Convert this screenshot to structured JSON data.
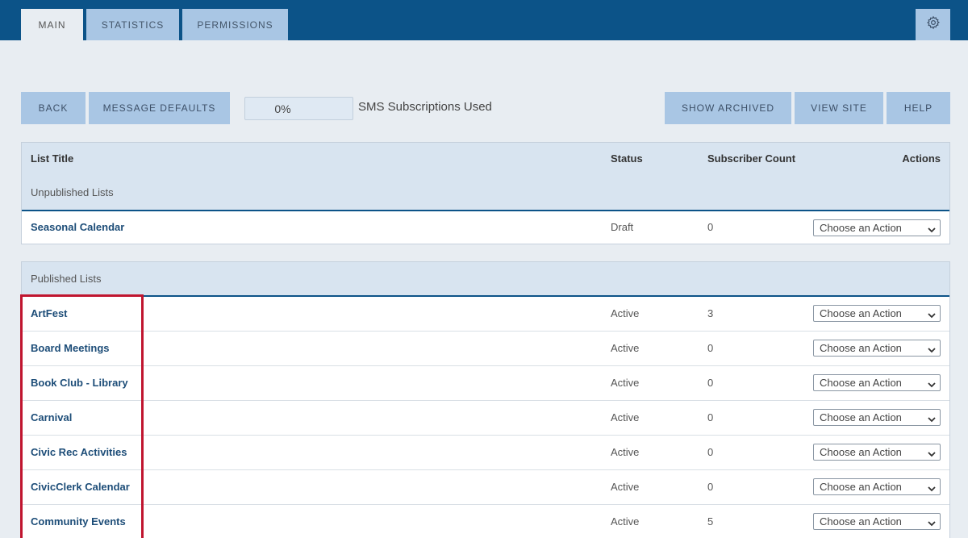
{
  "tabs": [
    {
      "label": "MAIN",
      "active": true
    },
    {
      "label": "STATISTICS",
      "active": false
    },
    {
      "label": "PERMISSIONS",
      "active": false
    }
  ],
  "icons": {
    "settings": "gear-icon",
    "select": "chevron-down-icon"
  },
  "toolbar": {
    "back_label": "BACK",
    "message_defaults_label": "MESSAGE DEFAULTS",
    "sms_percent": "0%",
    "sms_label": "SMS Subscriptions Used",
    "show_archived_label": "SHOW ARCHIVED",
    "view_site_label": "VIEW SITE",
    "help_label": "HELP"
  },
  "table": {
    "headers": {
      "title": "List Title",
      "status": "Status",
      "count": "Subscriber Count",
      "actions": "Actions"
    },
    "unpublished_label": "Unpublished Lists",
    "unpublished": [
      {
        "title": "Seasonal Calendar",
        "status": "Draft",
        "count": "0",
        "action": "Choose an Action"
      }
    ],
    "published_label": "Published Lists",
    "published": [
      {
        "title": "ArtFest",
        "status": "Active",
        "count": "3",
        "action": "Choose an Action"
      },
      {
        "title": "Board Meetings",
        "status": "Active",
        "count": "0",
        "action": "Choose an Action"
      },
      {
        "title": "Book Club - Library",
        "status": "Active",
        "count": "0",
        "action": "Choose an Action"
      },
      {
        "title": "Carnival",
        "status": "Active",
        "count": "0",
        "action": "Choose an Action"
      },
      {
        "title": "Civic Rec Activities",
        "status": "Active",
        "count": "0",
        "action": "Choose an Action"
      },
      {
        "title": "CivicClerk Calendar",
        "status": "Active",
        "count": "0",
        "action": "Choose an Action"
      },
      {
        "title": "Community Events",
        "status": "Active",
        "count": "5",
        "action": "Choose an Action"
      }
    ]
  },
  "colors": {
    "topbar": "#0c5388",
    "tab": "#a9c6e4",
    "highlight": "#c0152f",
    "link": "#1d4d78"
  }
}
